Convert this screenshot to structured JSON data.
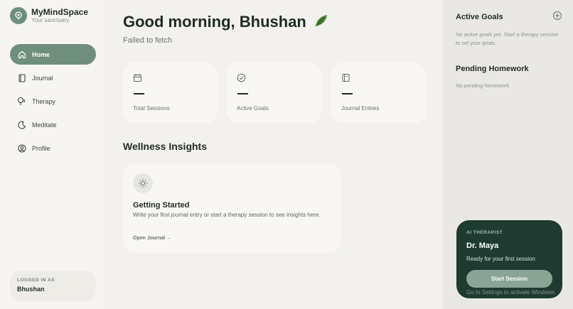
{
  "brand": {
    "name": "MyMindSpace",
    "tagline": "Your sanctuary",
    "icon": "brain-icon"
  },
  "nav": {
    "items": [
      {
        "label": "Home",
        "icon": "home-icon",
        "active": true
      },
      {
        "label": "Journal",
        "icon": "book-icon",
        "active": false
      },
      {
        "label": "Therapy",
        "icon": "therapy-icon",
        "active": false
      },
      {
        "label": "Meditate",
        "icon": "moon-icon",
        "active": false
      },
      {
        "label": "Profile",
        "icon": "user-icon",
        "active": false
      }
    ]
  },
  "account": {
    "label": "LOGGED IN AS",
    "name": "Bhushan"
  },
  "header": {
    "greeting": "Good morning, Bhushan",
    "emoji": "leaf-icon",
    "status": "Failed to fetch"
  },
  "stats": [
    {
      "label": "Total Sessions",
      "value": "—",
      "icon": "calendar-icon"
    },
    {
      "label": "Active Goals",
      "value": "—",
      "icon": "check-circle-icon"
    },
    {
      "label": "Journal Entries",
      "value": "—",
      "icon": "journal-icon"
    }
  ],
  "insights": {
    "section_title": "Wellness Insights",
    "card_title": "Getting Started",
    "card_text": "Write your first journal entry or start a therapy session to see insights here.",
    "link": "Open Journal →",
    "icon": "sun-icon"
  },
  "goals": {
    "title": "Active Goals",
    "empty": "No active goals yet. Start a therapy session to set your goals.",
    "add_icon": "plus-icon"
  },
  "homework": {
    "title": "Pending Homework",
    "empty": "No pending homework."
  },
  "ai_card": {
    "label": "AI THERAPIST",
    "name": "Dr. Maya",
    "status": "Ready for your first session",
    "button": "Start Session"
  },
  "overlay": {
    "activate_text": "Go to Settings to activate Windows."
  },
  "colors": {
    "accent": "#6f8f7d",
    "dark_card": "#1e3b31",
    "background": "#f3f1ed"
  }
}
